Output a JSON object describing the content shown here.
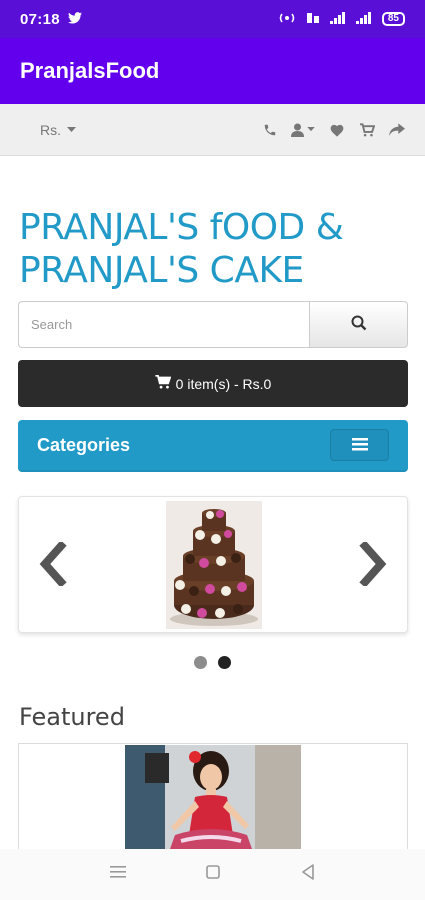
{
  "status_bar": {
    "time": "07:18",
    "battery": "85"
  },
  "app_bar": {
    "title": "PranjalsFood"
  },
  "top_bar": {
    "currency_label": "Rs.",
    "icons": [
      "phone-icon",
      "user-icon",
      "heart-icon",
      "cart-icon",
      "share-icon"
    ]
  },
  "site": {
    "title": "PRANJAL'S fOOD & PRANJAL'S CAKE"
  },
  "search": {
    "placeholder": "Search",
    "value": ""
  },
  "cart": {
    "label": "0 item(s) - Rs.0"
  },
  "categories": {
    "label": "Categories"
  },
  "slideshow": {
    "dots": 2,
    "active_dot": 2
  },
  "featured": {
    "title": "Featured"
  },
  "colors": {
    "status_bar": "#5a0fd6",
    "app_bar": "#6200ee",
    "accent": "#229ac8",
    "cart_button": "#2b2b2b"
  }
}
